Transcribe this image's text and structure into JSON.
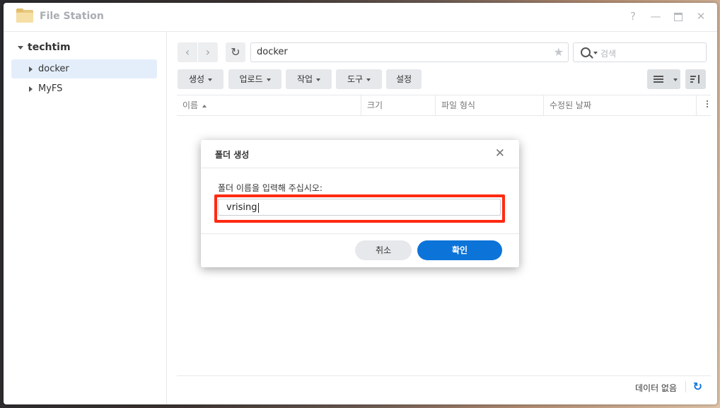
{
  "window": {
    "title": "File Station",
    "help_glyph": "?",
    "minimize_glyph": "—",
    "close_glyph": "✕"
  },
  "sidebar": {
    "root_label": "techtim",
    "items": [
      {
        "label": "docker",
        "selected": true
      },
      {
        "label": "MyFS",
        "selected": false
      }
    ]
  },
  "toolbar": {
    "back_glyph": "‹",
    "forward_glyph": "›",
    "refresh_glyph": "↻",
    "path": "docker",
    "star_glyph": "★",
    "search_placeholder": "검색",
    "buttons": [
      {
        "label": "생성",
        "has_dropdown": true
      },
      {
        "label": "업로드",
        "has_dropdown": true
      },
      {
        "label": "작업",
        "has_dropdown": true
      },
      {
        "label": "도구",
        "has_dropdown": true
      },
      {
        "label": "설정",
        "has_dropdown": false
      }
    ]
  },
  "columns": [
    "이름",
    "크기",
    "파일 형식",
    "수정된 날짜"
  ],
  "status": {
    "text": "데이터 없음",
    "refresh_glyph": "↻"
  },
  "dialog": {
    "title": "폴더 생성",
    "close_glyph": "✕",
    "prompt": "폴더 이름을 입력해 주십시오:",
    "input_value": "vrising",
    "cancel_label": "취소",
    "ok_label": "확인",
    "highlight_color": "#ff2a12"
  },
  "colors": {
    "accent": "#0c74d9",
    "selected_bg": "#e4eefb"
  }
}
